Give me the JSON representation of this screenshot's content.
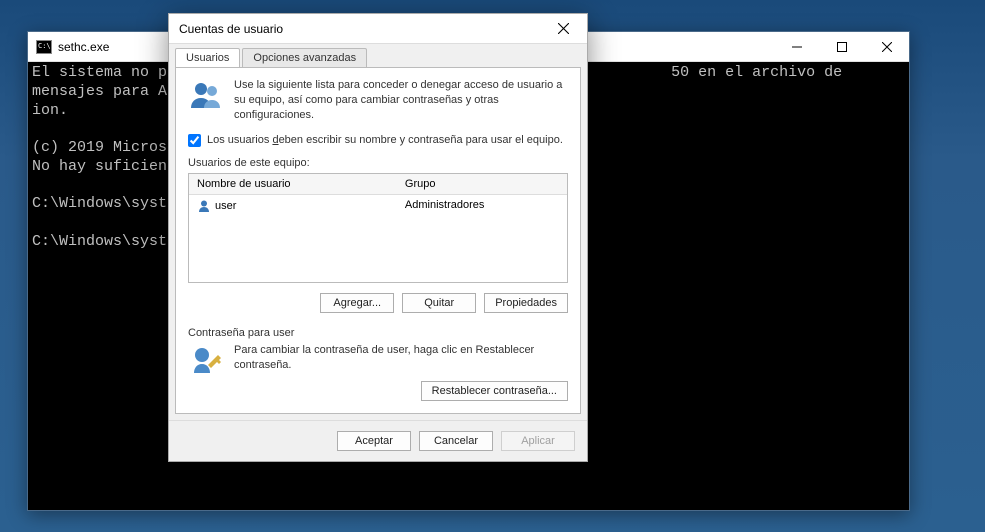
{
  "cmd": {
    "title": "sethc.exe",
    "lines": [
      "El sistema no puede                                                    50 en el archivo de mensajes para Applicat",
      "ion.",
      "",
      "(c) 2019 Microsoft C",
      "No hay suficientes r",
      "",
      "C:\\Windows\\system32>",
      "",
      "C:\\Windows\\system32>"
    ]
  },
  "dialog": {
    "title": "Cuentas de usuario",
    "tabs": {
      "users": "Usuarios",
      "advanced": "Opciones avanzadas"
    },
    "intro": "Use la siguiente lista para conceder o denegar acceso de usuario a su equipo, así como para cambiar contraseñas y otras configuraciones.",
    "checkbox_label_pre": "Los usuarios ",
    "checkbox_label_u": "d",
    "checkbox_label_post": "eben escribir su nombre y contraseña para usar el equipo.",
    "checkbox_checked": true,
    "users_label": "Usuarios de este equipo:",
    "columns": {
      "name": "Nombre de usuario",
      "group": "Grupo"
    },
    "rows": [
      {
        "name": "user",
        "group": "Administradores"
      }
    ],
    "buttons": {
      "add": "Agregar...",
      "remove": "Quitar",
      "props": "Propiedades"
    },
    "password_section": {
      "title": "Contraseña para user",
      "text": "Para cambiar la contraseña de user, haga clic en Restablecer contraseña.",
      "reset": "Restablecer contraseña..."
    },
    "footer": {
      "ok": "Aceptar",
      "cancel": "Cancelar",
      "apply": "Aplicar"
    }
  }
}
